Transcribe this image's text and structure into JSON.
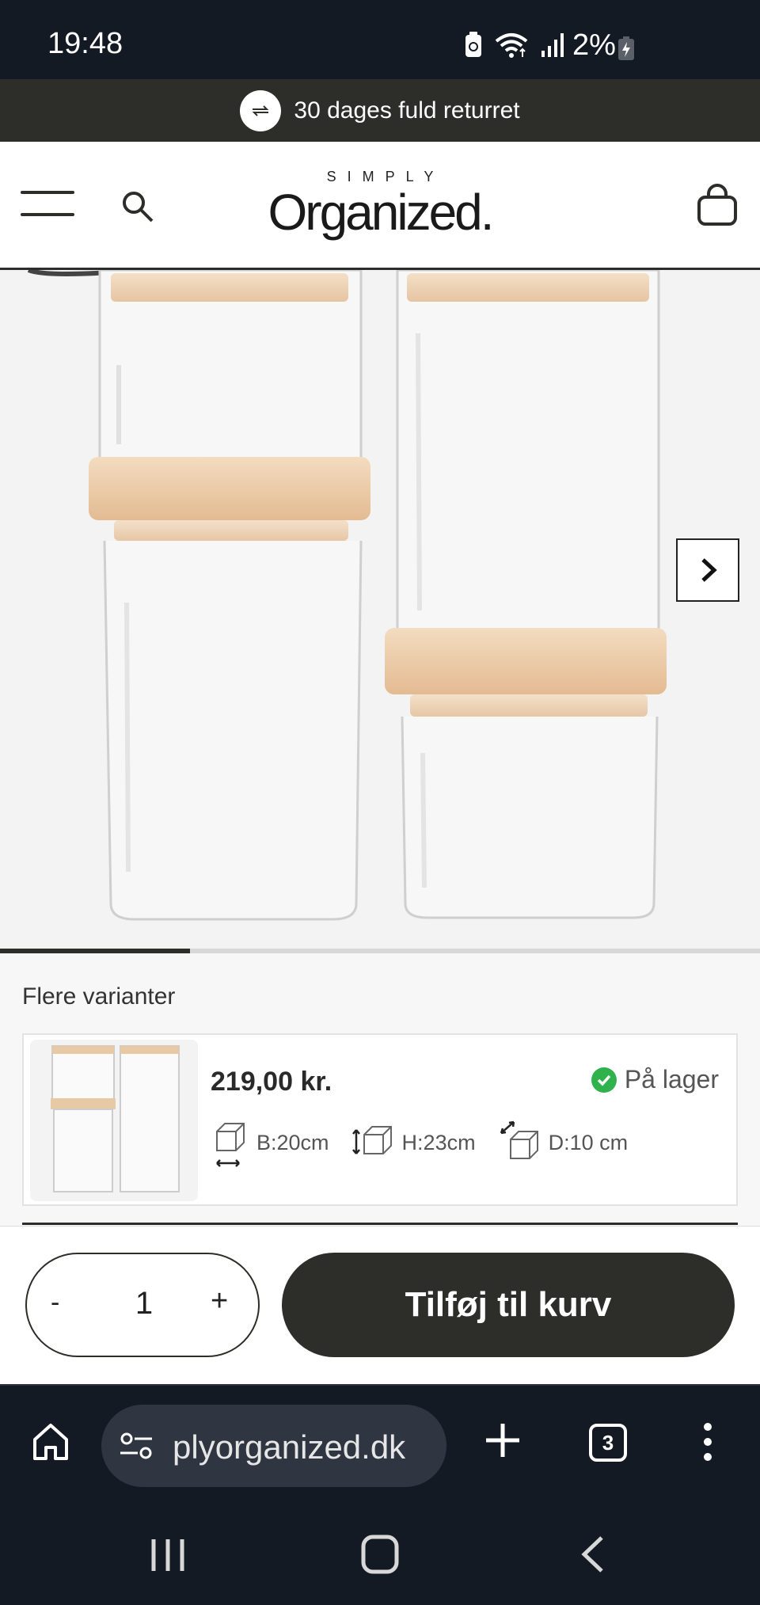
{
  "status_bar": {
    "time": "19:48",
    "battery": "2%",
    "icons": [
      "battery-saver-icon",
      "wifi-icon",
      "signal-icon",
      "battery-charging-icon"
    ]
  },
  "announcement": {
    "text": "30 dages fuld returret",
    "icon": "return-arrows-icon"
  },
  "header": {
    "logo_small": "SIMPLY",
    "logo_main": "Organized.",
    "icons": [
      "menu-icon",
      "search-icon",
      "bag-icon"
    ]
  },
  "gallery": {
    "next_icon": "chevron-right-icon",
    "slide_position": 0.25
  },
  "variants": {
    "title": "Flere varianter",
    "item": {
      "price": "219,00 kr.",
      "stock": "På lager",
      "dims": [
        {
          "label": "B:20cm",
          "icon": "box-width-icon"
        },
        {
          "label": "H:23cm",
          "icon": "box-height-icon"
        },
        {
          "label": "D:10 cm",
          "icon": "box-depth-icon"
        }
      ]
    }
  },
  "cart": {
    "minus": "-",
    "quantity": "1",
    "plus": "+",
    "add_label": "Tilføj til kurv"
  },
  "browser": {
    "url": "plyorganized.dk",
    "tab_count": "3"
  },
  "colors": {
    "dark": "#2d2e29",
    "status_bg": "#141a24",
    "in_stock_green": "#2fb24c"
  }
}
